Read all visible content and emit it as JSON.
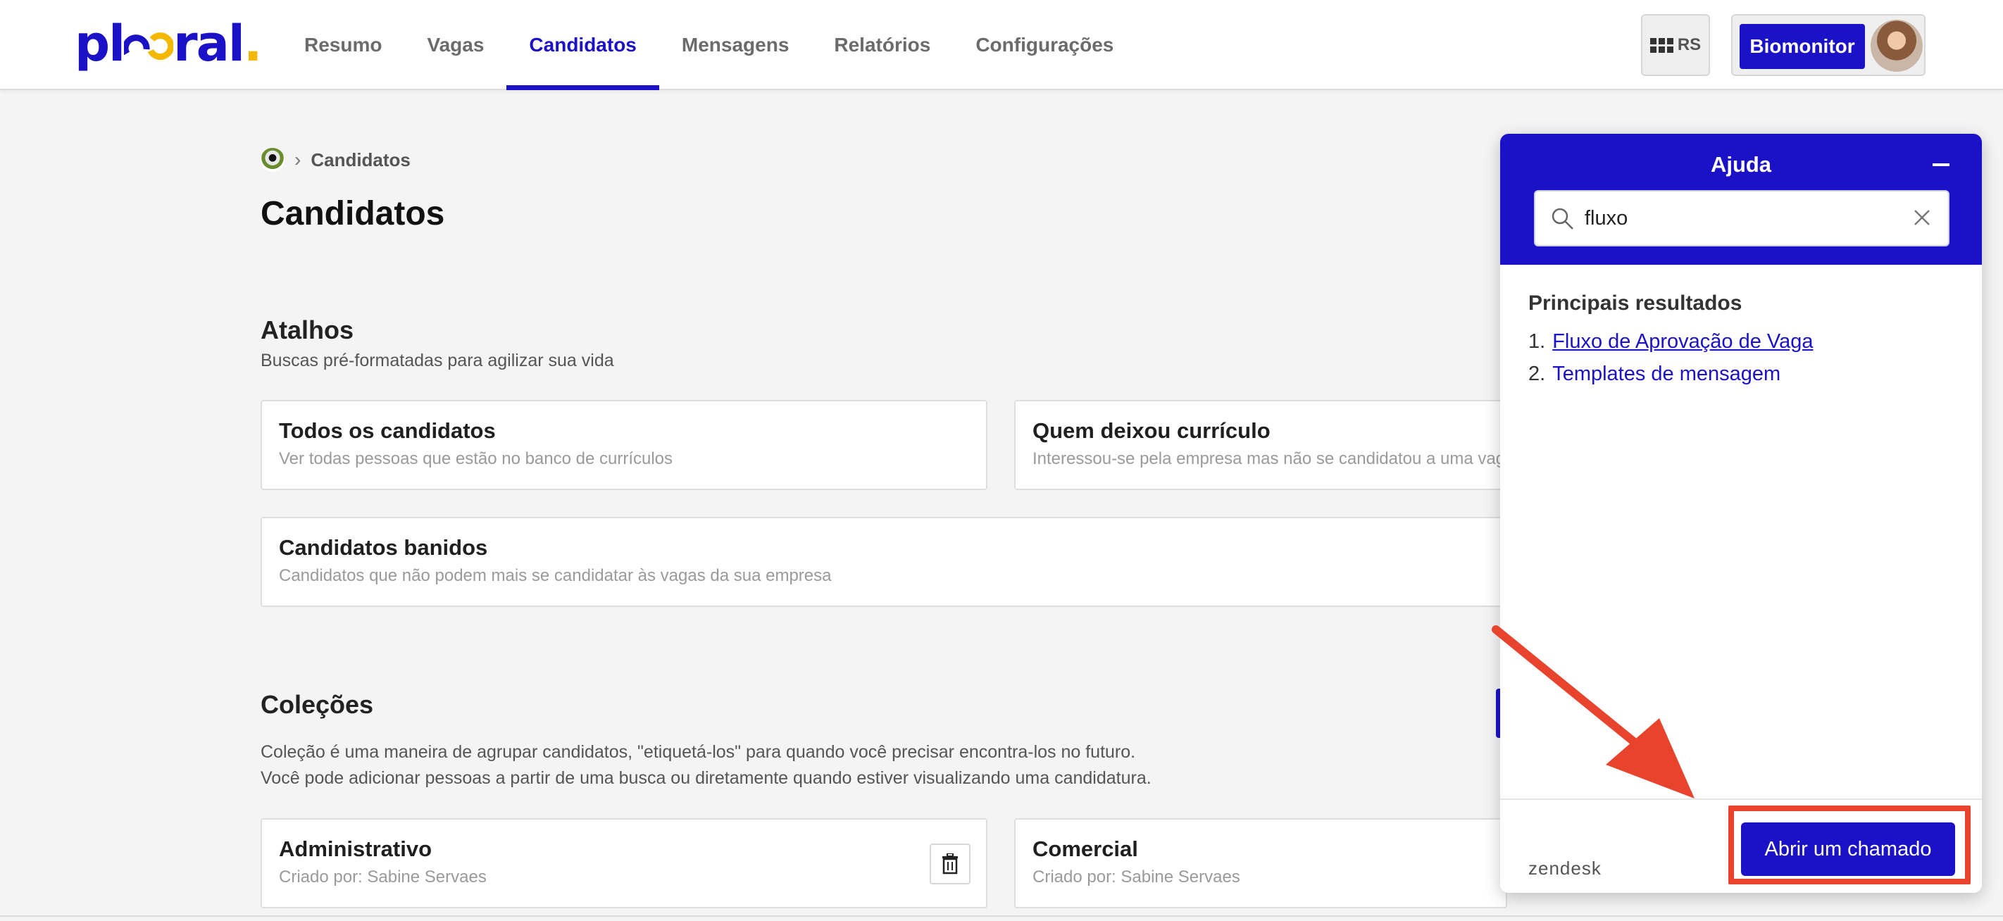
{
  "header": {
    "logo_main": "pl",
    "logo_mid": "ral",
    "logo_dot": ".",
    "nav": [
      {
        "label": "Resumo"
      },
      {
        "label": "Vagas"
      },
      {
        "label": "Candidatos",
        "active": true
      },
      {
        "label": "Mensagens"
      },
      {
        "label": "Relatórios"
      },
      {
        "label": "Configurações"
      }
    ],
    "apps_label": "RS",
    "account_name": "Biomonitor"
  },
  "breadcrumb": {
    "current": "Candidatos"
  },
  "page_title": "Candidatos",
  "shortcuts": {
    "title": "Atalhos",
    "subtitle": "Buscas pré-formatadas para agilizar sua vida",
    "cards": [
      {
        "title": "Todos os candidatos",
        "desc": "Ver todas pessoas que estão no banco de currículos"
      },
      {
        "title": "Quem deixou currículo",
        "desc": "Interessou-se pela empresa mas não se candidatou a uma vaga e"
      },
      {
        "title": "Candidatos banidos",
        "desc": "Candidatos que não podem mais se candidatar às vagas da sua empresa"
      }
    ]
  },
  "collections": {
    "title": "Coleções",
    "desc_line1": "Coleção é uma maneira de agrupar candidatos, \"etiquetá-los\" para quando você precisar encontra-los no futuro.",
    "desc_line2": "Você pode adicionar pessoas a partir de uma busca ou diretamente quando estiver visualizando uma candidatura.",
    "cards": [
      {
        "title": "Administrativo",
        "desc": "Criado por: Sabine Servaes"
      },
      {
        "title": "Comercial",
        "desc": "Criado por: Sabine Servaes"
      }
    ]
  },
  "help": {
    "title": "Ajuda",
    "search_value": "fluxo",
    "results_title": "Principais resultados",
    "results": [
      {
        "num": "1.",
        "label": "Fluxo de Aprovação de Vaga"
      },
      {
        "num": "2.",
        "label": "Templates de mensagem"
      }
    ],
    "brand": "zendesk",
    "ticket_button": "Abrir um chamado"
  },
  "colors": {
    "brand": "#1b12c7",
    "accent_yellow": "#f5b800",
    "annotation": "#e8432c"
  }
}
